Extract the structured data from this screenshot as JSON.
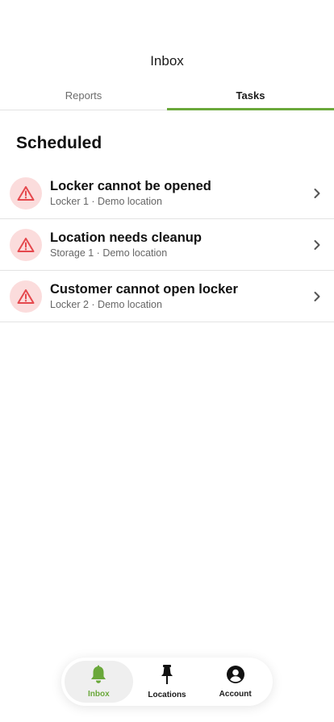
{
  "header": {
    "title": "Inbox"
  },
  "tabs": [
    {
      "label": "Reports",
      "active": false
    },
    {
      "label": "Tasks",
      "active": true
    }
  ],
  "section": {
    "title": "Scheduled"
  },
  "tasks": [
    {
      "title": "Locker cannot be opened",
      "subtitle": "Locker 1 · Demo location",
      "icon": "warning-icon"
    },
    {
      "title": "Location needs cleanup",
      "subtitle": "Storage 1 · Demo location",
      "icon": "warning-icon"
    },
    {
      "title": "Customer cannot open locker",
      "subtitle": "Locker 2 · Demo location",
      "icon": "warning-icon"
    }
  ],
  "nav": {
    "items": [
      {
        "label": "Inbox",
        "icon": "bell-icon",
        "active": true
      },
      {
        "label": "Locations",
        "icon": "pin-icon",
        "active": false
      },
      {
        "label": "Account",
        "icon": "account-icon",
        "active": false
      }
    ]
  },
  "colors": {
    "accent": "#6aa83a",
    "warning": "#e5484d",
    "warning_bg": "#fbdcdc"
  }
}
